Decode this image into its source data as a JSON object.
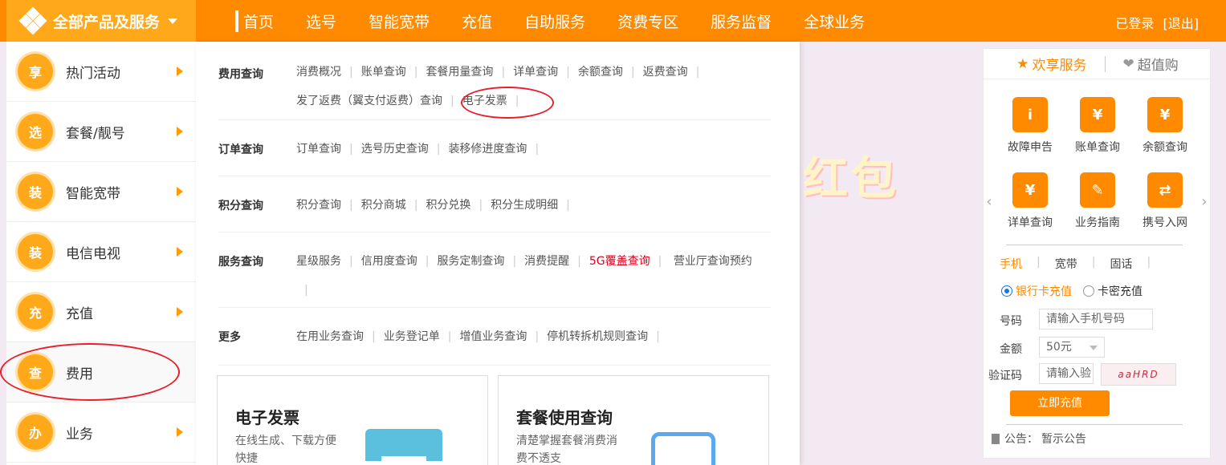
{
  "header": {
    "all_products": "全部产品及服务",
    "nav": [
      "首页",
      "选号",
      "智能宽带",
      "充值",
      "自助服务",
      "资费专区",
      "服务监督",
      "全球业务"
    ],
    "login_text": "已登录",
    "logout_text": "[退出]"
  },
  "sidebar": {
    "items": [
      {
        "icon": "享",
        "label": "热门活动",
        "arrow": true
      },
      {
        "icon": "选",
        "label": "套餐/靓号",
        "arrow": true
      },
      {
        "icon": "装",
        "label": "智能宽带",
        "arrow": true
      },
      {
        "icon": "装",
        "label": "电信电视",
        "arrow": true
      },
      {
        "icon": "充",
        "label": "充值",
        "arrow": true
      },
      {
        "icon": "查",
        "label": "费用",
        "arrow": false
      },
      {
        "icon": "办",
        "label": "业务",
        "arrow": true
      }
    ]
  },
  "menu": {
    "sections": [
      {
        "title": "费用查询",
        "links": [
          "消费概况",
          "账单查询",
          "套餐用量查询",
          "详单查询",
          "余额查询",
          "返费查询",
          "发了返费（翼支付返费）查询",
          "电子发票"
        ]
      },
      {
        "title": "订单查询",
        "links": [
          "订单查询",
          "选号历史查询",
          "装移修进度查询"
        ]
      },
      {
        "title": "积分查询",
        "links": [
          "积分查询",
          "积分商城",
          "积分兑换",
          "积分生成明细"
        ]
      },
      {
        "title": "服务查询",
        "links": [
          "星级服务",
          "信用度查询",
          "服务定制查询",
          "消费提醒",
          "5G覆盖查询",
          "营业厅查询预约"
        ]
      },
      {
        "title": "更多",
        "links": [
          "在用业务查询",
          "业务登记单",
          "增值业务查询",
          "停机转拆机规则查询"
        ]
      }
    ],
    "cards": [
      {
        "title": "电子发票",
        "sub": "在线生成、下载方便快捷"
      },
      {
        "title": "套餐使用查询",
        "sub": "清楚掌握套餐消费消费不透支"
      }
    ]
  },
  "promo": {
    "text": "红包"
  },
  "right_panel": {
    "tabs": [
      {
        "icon": "★",
        "label": "欢享服务"
      },
      {
        "icon": "❤",
        "label": "超值购"
      }
    ],
    "services": [
      {
        "icon": "i",
        "label": "故障申告"
      },
      {
        "icon": "¥",
        "label": "账单查询"
      },
      {
        "icon": "¥",
        "label": "余额查询"
      },
      {
        "icon": "¥",
        "label": "详单查询"
      },
      {
        "icon": "✎",
        "label": "业务指南"
      },
      {
        "icon": "⇄",
        "label": "携号入网"
      }
    ],
    "recharge_tabs": [
      "手机",
      "宽带",
      "固话"
    ],
    "methods": [
      "银行卡充值",
      "卡密充值"
    ],
    "fields": {
      "number_label": "号码",
      "number_placeholder": "请输入手机号码",
      "amount_label": "金额",
      "amount_value": "50元",
      "captcha_label": "验证码",
      "captcha_placeholder": "请输入验",
      "captcha_text": "aaHRD"
    },
    "submit": "立即充值",
    "notice_label": "公告：",
    "notice_text": "暂示公告"
  },
  "colors": {
    "primary": "#ff8a00",
    "secondary": "#ffa81a",
    "hot": "#d9001b",
    "annotation": "#e8202c"
  }
}
